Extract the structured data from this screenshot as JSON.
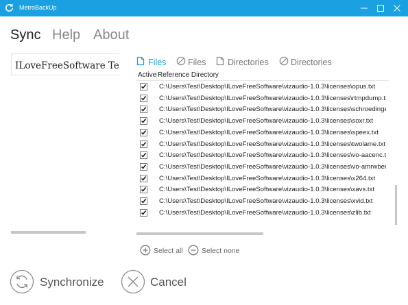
{
  "window": {
    "title": "MetroBackUp",
    "accent": "#1ba1e2"
  },
  "menu": {
    "sync": "Sync",
    "help": "Help",
    "about": "About"
  },
  "left_panel": {
    "selected_item": "ILoveFreeSoftware Test F"
  },
  "tabs": {
    "files_included": "Files",
    "files_excluded": "Files",
    "dirs_included": "Directories",
    "dirs_excluded": "Directories"
  },
  "table": {
    "headers": {
      "active": "Active",
      "reference": "Reference Directory"
    },
    "rows": [
      "C:\\Users\\Test\\Desktop\\ILoveFreeSoftware\\vizaudio-1.0.3\\licenses\\opus.txt",
      "C:\\Users\\Test\\Desktop\\ILoveFreeSoftware\\vizaudio-1.0.3\\licenses\\rtmpdump.txt",
      "C:\\Users\\Test\\Desktop\\ILoveFreeSoftware\\vizaudio-1.0.3\\licenses\\schroedinger.txt",
      "C:\\Users\\Test\\Desktop\\ILoveFreeSoftware\\vizaudio-1.0.3\\licenses\\soxr.txt",
      "C:\\Users\\Test\\Desktop\\ILoveFreeSoftware\\vizaudio-1.0.3\\licenses\\speex.txt",
      "C:\\Users\\Test\\Desktop\\ILoveFreeSoftware\\vizaudio-1.0.3\\licenses\\twolame.txt",
      "C:\\Users\\Test\\Desktop\\ILoveFreeSoftware\\vizaudio-1.0.3\\licenses\\vo-aacenc.txt",
      "C:\\Users\\Test\\Desktop\\ILoveFreeSoftware\\vizaudio-1.0.3\\licenses\\vo-amrwbenc.txt",
      "C:\\Users\\Test\\Desktop\\ILoveFreeSoftware\\vizaudio-1.0.3\\licenses\\x264.txt",
      "C:\\Users\\Test\\Desktop\\ILoveFreeSoftware\\vizaudio-1.0.3\\licenses\\xavs.txt",
      "C:\\Users\\Test\\Desktop\\ILoveFreeSoftware\\vizaudio-1.0.3\\licenses\\xvid.txt",
      "C:\\Users\\Test\\Desktop\\ILoveFreeSoftware\\vizaudio-1.0.3\\licenses\\zlib.txt"
    ]
  },
  "actions": {
    "select_all": "Select all",
    "select_none": "Select none"
  },
  "buttons": {
    "synchronize": "Synchronize",
    "cancel": "Cancel"
  }
}
